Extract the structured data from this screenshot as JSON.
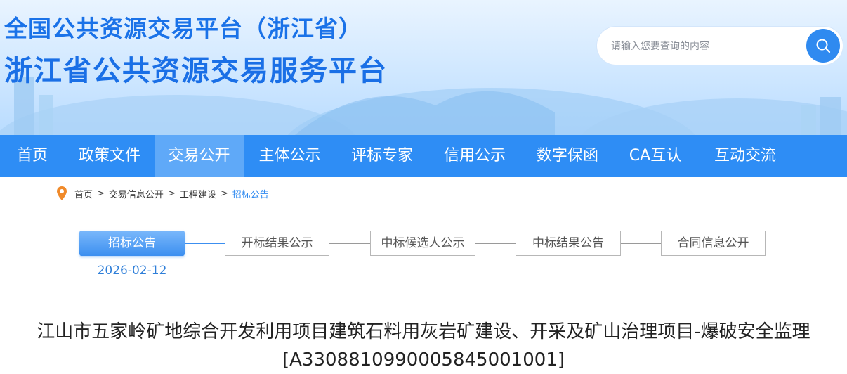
{
  "header": {
    "title_line1": "全国公共资源交易平台（浙江省）",
    "title_line2": "浙江省公共资源交易服务平台",
    "search_placeholder": "请输入您要查询的内容"
  },
  "nav": {
    "items": [
      "首页",
      "政策文件",
      "交易公开",
      "主体公示",
      "评标专家",
      "信用公示",
      "数字保函",
      "CA互认",
      "互动交流"
    ],
    "active_index": 2
  },
  "breadcrumb": [
    "首页",
    "交易信息公开",
    "工程建设",
    "招标公告"
  ],
  "steps": {
    "items": [
      "招标公告",
      "开标结果公示",
      "中标候选人公示",
      "中标结果公告",
      "合同信息公开"
    ],
    "active_index": 0,
    "active_date": "2026-02-12"
  },
  "article": {
    "title": "江山市五家岭矿地综合开发利用项目建筑石料用灰岩矿建设、开采及矿山治理项目-爆破安全监理[A3308810990005845001001]"
  },
  "colors": {
    "nav_bg": "#2e8df5",
    "nav_active": "#5fa9f8",
    "title_blue": "#1a72e8",
    "accent": "#2f8af0"
  }
}
